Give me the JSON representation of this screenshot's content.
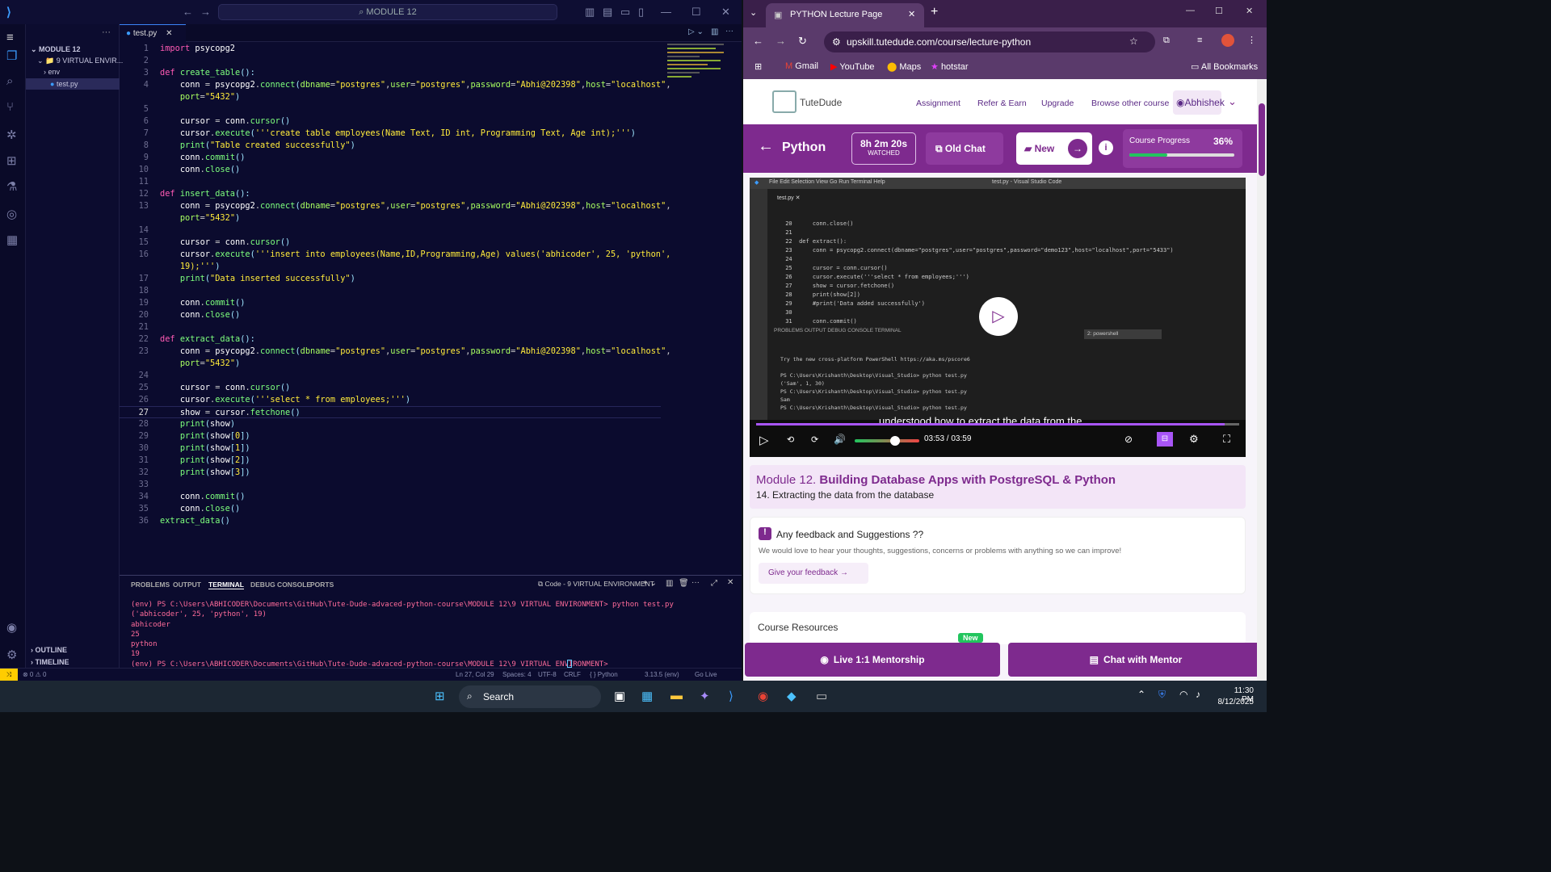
{
  "vscode": {
    "search": "MODULE 12",
    "sidebar": {
      "folder": "MODULE 12",
      "venv": "9 VIRTUAL ENVIR...",
      "items": [
        "env",
        "test.py"
      ],
      "outline": "OUTLINE",
      "timeline": "TIMELINE"
    },
    "tab": "test.py",
    "code": [
      {
        "n": "1",
        "html": "<span class='k'>import</span> <span class='v'>psycopg2</span>"
      },
      {
        "n": "2",
        "html": ""
      },
      {
        "n": "3",
        "html": "<span class='k'>def</span> <span class='f'>create_table</span><span class='p'>():</span>"
      },
      {
        "n": "4",
        "html": "    <span class='v'>conn</span> = <span class='v'>psycopg2</span>.<span class='f'>connect</span><span class='p'>(</span><span class='d'>dbname</span>=<span class='s'>\"postgres\"</span>,<span class='d'>user</span>=<span class='s'>\"postgres\"</span>,<span class='d'>password</span>=<span class='s'>\"Abhi@202398\"</span>,<span class='d'>host</span>=<span class='s'>\"localhost\"</span>,"
      },
      {
        "n": "",
        "html": "    <span class='d'>port</span>=<span class='s'>\"5432\"</span><span class='p'>)</span>"
      },
      {
        "n": "5",
        "html": ""
      },
      {
        "n": "6",
        "html": "    <span class='v'>cursor</span> = <span class='v'>conn</span>.<span class='f'>cursor</span><span class='p'>()</span>"
      },
      {
        "n": "7",
        "html": "    <span class='v'>cursor</span>.<span class='f'>execute</span><span class='p'>(</span><span class='s'>'''create table employees(Name Text, ID int, Programming Text, Age int);'''</span><span class='p'>)</span>"
      },
      {
        "n": "8",
        "html": "    <span class='f'>print</span><span class='p'>(</span><span class='s'>\"Table created successfully\"</span><span class='p'>)</span>"
      },
      {
        "n": "9",
        "html": "    <span class='v'>conn</span>.<span class='f'>commit</span><span class='p'>()</span>"
      },
      {
        "n": "10",
        "html": "    <span class='v'>conn</span>.<span class='f'>close</span><span class='p'>()</span>"
      },
      {
        "n": "11",
        "html": ""
      },
      {
        "n": "12",
        "html": "<span class='k'>def</span> <span class='f'>insert_data</span><span class='p'>():</span>"
      },
      {
        "n": "13",
        "html": "    <span class='v'>conn</span> = <span class='v'>psycopg2</span>.<span class='f'>connect</span><span class='p'>(</span><span class='d'>dbname</span>=<span class='s'>\"postgres\"</span>,<span class='d'>user</span>=<span class='s'>\"postgres\"</span>,<span class='d'>password</span>=<span class='s'>\"Abhi@202398\"</span>,<span class='d'>host</span>=<span class='s'>\"localhost\"</span>,"
      },
      {
        "n": "",
        "html": "    <span class='d'>port</span>=<span class='s'>\"5432\"</span><span class='p'>)</span>"
      },
      {
        "n": "14",
        "html": ""
      },
      {
        "n": "15",
        "html": "    <span class='v'>cursor</span> = <span class='v'>conn</span>.<span class='f'>cursor</span><span class='p'>()</span>"
      },
      {
        "n": "16",
        "html": "    <span class='v'>cursor</span>.<span class='f'>execute</span><span class='p'>(</span><span class='s'>'''insert into employees(Name,ID,Programming,Age) values('abhicoder', 25, 'python',</span>"
      },
      {
        "n": "",
        "html": "    <span class='s'>19);'''</span><span class='p'>)</span>"
      },
      {
        "n": "17",
        "html": "    <span class='f'>print</span><span class='p'>(</span><span class='s'>\"Data inserted successfully\"</span><span class='p'>)</span>"
      },
      {
        "n": "18",
        "html": ""
      },
      {
        "n": "19",
        "html": "    <span class='v'>conn</span>.<span class='f'>commit</span><span class='p'>()</span>"
      },
      {
        "n": "20",
        "html": "    <span class='v'>conn</span>.<span class='f'>close</span><span class='p'>()</span>"
      },
      {
        "n": "21",
        "html": ""
      },
      {
        "n": "22",
        "html": "<span class='k'>def</span> <span class='f'>extract_data</span><span class='p'>():</span>"
      },
      {
        "n": "23",
        "html": "    <span class='v'>conn</span> = <span class='v'>psycopg2</span>.<span class='f'>connect</span><span class='p'>(</span><span class='d'>dbname</span>=<span class='s'>\"postgres\"</span>,<span class='d'>user</span>=<span class='s'>\"postgres\"</span>,<span class='d'>password</span>=<span class='s'>\"Abhi@202398\"</span>,<span class='d'>host</span>=<span class='s'>\"localhost\"</span>,"
      },
      {
        "n": "",
        "html": "    <span class='d'>port</span>=<span class='s'>\"5432\"</span><span class='p'>)</span>"
      },
      {
        "n": "24",
        "html": ""
      },
      {
        "n": "25",
        "html": "    <span class='v'>cursor</span> = <span class='v'>conn</span>.<span class='f'>cursor</span><span class='p'>()</span>"
      },
      {
        "n": "26",
        "html": "    <span class='v'>cursor</span>.<span class='f'>execute</span><span class='p'>(</span><span class='s'>'''select * from employees;'''</span><span class='p'>)</span>"
      },
      {
        "n": "27",
        "html": "    <span class='v'>show</span> = <span class='v'>cursor</span>.<span class='f'>fetchone</span><span class='p'>()</span>"
      },
      {
        "n": "28",
        "html": "    <span class='f'>print</span><span class='p'>(</span><span class='v'>show</span><span class='p'>)</span>"
      },
      {
        "n": "29",
        "html": "    <span class='f'>print</span><span class='p'>(</span><span class='v'>show</span><span class='p'>[</span><span class='s'>0</span><span class='p'>])</span>"
      },
      {
        "n": "30",
        "html": "    <span class='f'>print</span><span class='p'>(</span><span class='v'>show</span><span class='p'>[</span><span class='s'>1</span><span class='p'>])</span>"
      },
      {
        "n": "31",
        "html": "    <span class='f'>print</span><span class='p'>(</span><span class='v'>show</span><span class='p'>[</span><span class='s'>2</span><span class='p'>])</span>"
      },
      {
        "n": "32",
        "html": "    <span class='f'>print</span><span class='p'>(</span><span class='v'>show</span><span class='p'>[</span><span class='s'>3</span><span class='p'>])</span>"
      },
      {
        "n": "33",
        "html": ""
      },
      {
        "n": "34",
        "html": "    <span class='v'>conn</span>.<span class='f'>commit</span><span class='p'>()</span>"
      },
      {
        "n": "35",
        "html": "    <span class='v'>conn</span>.<span class='f'>close</span><span class='p'>()</span>"
      },
      {
        "n": "36",
        "html": "<span class='f'>extract_data</span><span class='p'>()</span>"
      }
    ],
    "panel_tabs": [
      "PROBLEMS",
      "OUTPUT",
      "TERMINAL",
      "DEBUG CONSOLE",
      "PORTS"
    ],
    "terminal_name": "Code - 9 VIRTUAL ENVIRONMENT",
    "terminal": "(env) PS C:\\Users\\ABHICODER\\Documents\\GitHub\\Tute-Dude-advaced-python-course\\MODULE 12\\9 VIRTUAL ENVIRONMENT> python test.py\n('abhicoder', 25, 'python', 19)\nabhicoder\n25\npython\n19\n(env) PS C:\\Users\\ABHICODER\\Documents\\GitHub\\Tute-Dude-advaced-python-course\\MODULE 12\\9 VIRTUAL ENVIRONMENT> ",
    "status": {
      "errors": "⊗ 0 ⚠ 0",
      "pos": "Ln 27, Col 29",
      "spaces": "Spaces: 4",
      "enc": "UTF-8",
      "eol": "CRLF",
      "lang": "{ } Python",
      "env": "3.13.5 (env)",
      "live": "Go Live"
    }
  },
  "chrome": {
    "tab_title": "PYTHON Lecture Page",
    "url": "upskill.tutedude.com/course/lecture-python",
    "bookmarks": [
      "Gmail",
      "YouTube",
      "Maps",
      "hotstar"
    ],
    "all_bookmarks": "All Bookmarks"
  },
  "tutedude": {
    "logo": "TuteDude",
    "nav": [
      "Assignment",
      "Refer & Earn",
      "Upgrade",
      "Browse other course"
    ],
    "user": "Abhishek",
    "course": "Python",
    "watched_time": "8h 2m 20s",
    "watched_label": "WATCHED",
    "old_chat": "Old Chat",
    "new_label": "New",
    "progress_label": "Course Progress",
    "progress_value": "36%",
    "progress_fraction": 0.36,
    "video_time": "03:53 / 03:59",
    "video_progress": 0.97,
    "caption": "understood how to extract the data from the",
    "inner_title": "test.py - Visual Studio Code",
    "inner_menu": [
      "File",
      "Edit",
      "Selection",
      "View",
      "Go",
      "Run",
      "Terminal",
      "Help"
    ],
    "inner_code": [
      {
        "n": "20",
        "t": "    conn.close()"
      },
      {
        "n": "21",
        "t": ""
      },
      {
        "n": "22",
        "t": "def extract():"
      },
      {
        "n": "23",
        "t": "    conn = psycopg2.connect(dbname=\"postgres\",user=\"postgres\",password=\"demo123\",host=\"localhost\",port=\"5433\")"
      },
      {
        "n": "24",
        "t": ""
      },
      {
        "n": "25",
        "t": "    cursor = conn.cursor()"
      },
      {
        "n": "26",
        "t": "    cursor.execute('''select * from employees;''')"
      },
      {
        "n": "27",
        "t": "    show = cursor.fetchone()"
      },
      {
        "n": "28",
        "t": "    print(show[2])"
      },
      {
        "n": "29",
        "t": "    #print('Data added successfully')"
      },
      {
        "n": "30",
        "t": ""
      },
      {
        "n": "31",
        "t": "    conn.commit()"
      }
    ],
    "inner_panel_tabs": [
      "PROBLEMS",
      "OUTPUT",
      "DEBUG CONSOLE",
      "TERMINAL"
    ],
    "inner_terminal_select": "2: powershell",
    "inner_terminal": "Try the new cross-platform PowerShell https://aka.ms/pscore6\n\nPS C:\\Users\\Krishanth\\Desktop\\Visual_Studio> python test.py\n('Sam', 1, 30)\nPS C:\\Users\\Krishanth\\Desktop\\Visual_Studio> python test.py\nSam\nPS C:\\Users\\Krishanth\\Desktop\\Visual_Studio> python test.py",
    "module_prefix": "Module 12.",
    "module_title": "Building Database Apps with PostgreSQL & Python",
    "lecture": "14. Extracting the data from the database",
    "fb_title": "Any feedback and Suggestions ??",
    "fb_text": "We would love to hear your thoughts, suggestions, concerns or problems with anything so we can improve!",
    "fb_button": "Give your feedback",
    "resources": "Course Resources",
    "mentor_btn": "Live 1:1 Mentorship",
    "mentor_badge": "New",
    "chat_btn": "Chat with Mentor"
  },
  "taskbar": {
    "search": "Search",
    "time": "11:30 PM",
    "date": "8/12/2025"
  },
  "colors": {
    "brand": "#7e2a8e",
    "vs_bg": "#0b0b2e"
  }
}
